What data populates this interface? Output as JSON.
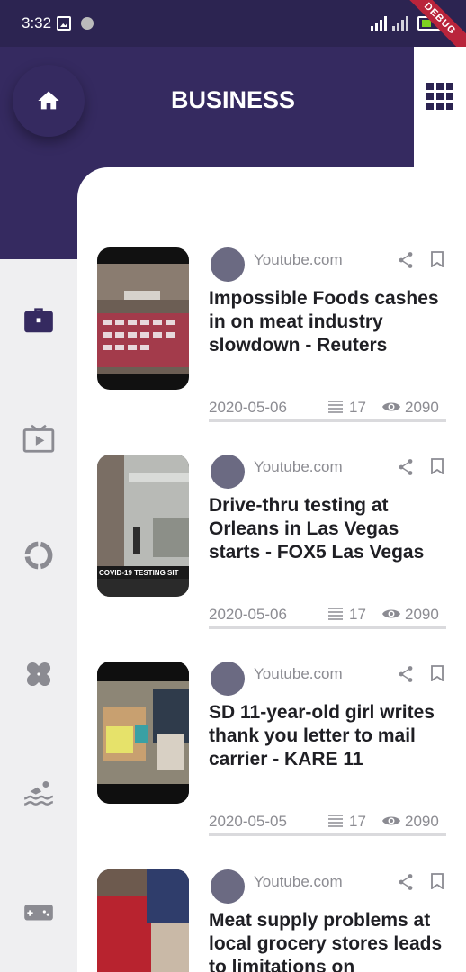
{
  "status_bar": {
    "time": "3:32",
    "network": "3G"
  },
  "debug_banner": "DEBUG",
  "header": {
    "title": "BUSINESS"
  },
  "sidebar": {
    "items": [
      {
        "icon": "briefcase-icon",
        "active": true
      },
      {
        "icon": "tv-play-icon",
        "active": false
      },
      {
        "icon": "circle-ring-icon",
        "active": false
      },
      {
        "icon": "bandage-icon",
        "active": false
      },
      {
        "icon": "swimming-icon",
        "active": false
      },
      {
        "icon": "gamepad-icon",
        "active": false
      }
    ]
  },
  "colors": {
    "header_bg": "#352a60",
    "statusbar_bg": "#2c2451",
    "accent": "#2c2451"
  },
  "articles": [
    {
      "source": "Youtube.com",
      "title": "Impossible Foods cashes in on meat industry slowdown - Reuters",
      "date": "2020-05-06",
      "count": "17",
      "views": "2090"
    },
    {
      "source": "Youtube.com",
      "title": "Drive-thru testing at Orleans in Las Vegas starts - FOX5 Las Vegas",
      "date": "2020-05-06",
      "count": "17",
      "views": "2090"
    },
    {
      "source": "Youtube.com",
      "title": "SD 11-year-old girl writes thank you letter to mail carrier - KARE 11",
      "date": "2020-05-05",
      "count": "17",
      "views": "2090"
    },
    {
      "source": "Youtube.com",
      "title": "Meat supply problems at local grocery stores leads to limitations on",
      "date": "",
      "count": "",
      "views": ""
    }
  ]
}
